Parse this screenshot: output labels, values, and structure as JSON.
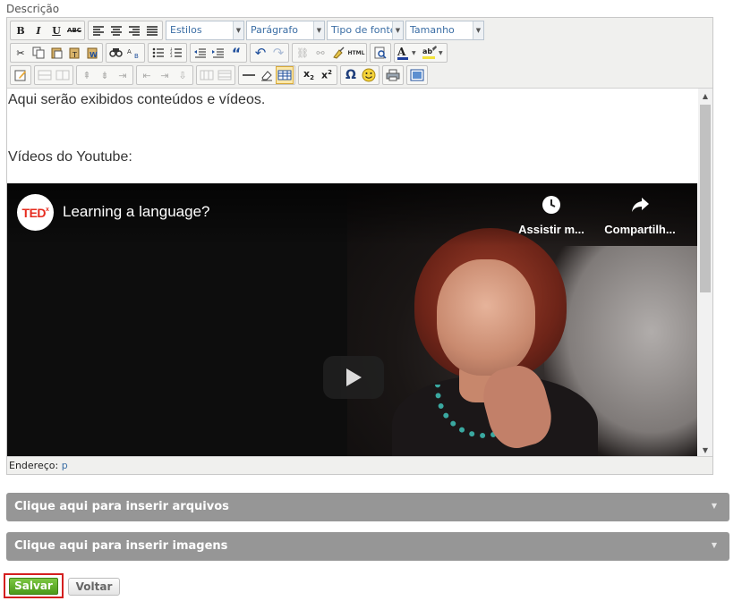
{
  "field": {
    "label": "Descrição"
  },
  "toolbar": {
    "format_buttons": [
      {
        "name": "bold-button",
        "glyph": "B"
      },
      {
        "name": "italic-button",
        "glyph": "I"
      },
      {
        "name": "underline-button",
        "glyph": "U"
      },
      {
        "name": "strikethrough-button",
        "glyph": "ABC"
      }
    ],
    "selects": {
      "styles": "Estilos",
      "paragraph": "Parágrafo",
      "font_type": "Tipo de fonte",
      "size": "Tamanho"
    },
    "html_button": "HTML"
  },
  "content": {
    "line1": "Aqui serão exibidos conteúdos e vídeos.",
    "line2": "Vídeos do Youtube:"
  },
  "video": {
    "logo": "TED",
    "logo_sup": "x",
    "title": "Learning a language?",
    "watch_later": "Assistir m...",
    "share": "Compartilh..."
  },
  "statusbar": {
    "label": "Endereço:",
    "path": "p"
  },
  "accordions": {
    "files": "Clique aqui para inserir arquivos",
    "images": "Clique aqui para inserir imagens"
  },
  "actions": {
    "save": "Salvar",
    "back": "Voltar"
  },
  "colors": {
    "save_green": "#5aaa26",
    "highlight_red": "#d41f1f",
    "accordion_gray": "#969696",
    "link_blue": "#3b6ea5"
  }
}
